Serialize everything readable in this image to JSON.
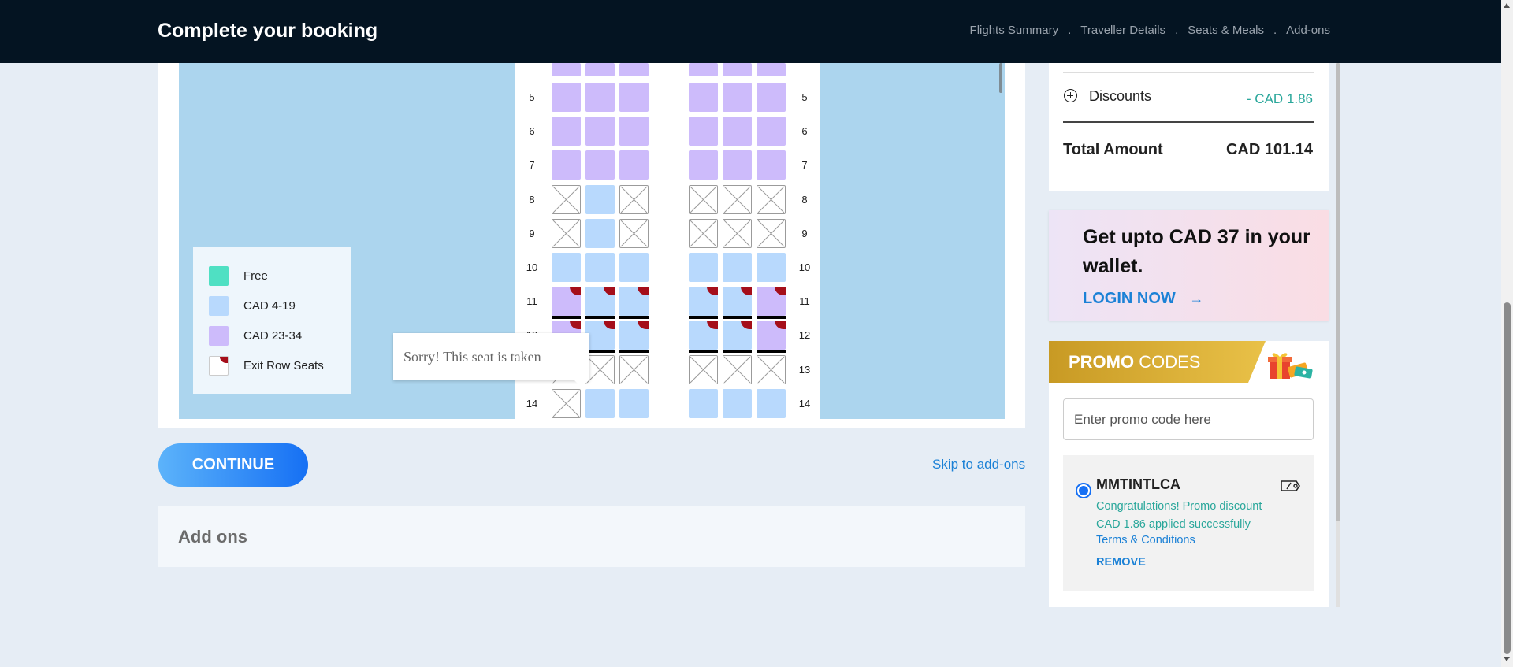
{
  "header": {
    "title": "Complete your booking",
    "steps": [
      "Flights Summary",
      "Traveller Details",
      "Seats & Meals",
      "Add-ons"
    ],
    "separator": "."
  },
  "seat_map": {
    "rows": [
      {
        "number": "5",
        "seats": [
          "purple",
          "purple",
          "purple",
          "purple",
          "purple",
          "purple"
        ],
        "exit": false
      },
      {
        "number": "6",
        "seats": [
          "purple",
          "purple",
          "purple",
          "purple",
          "purple",
          "purple"
        ],
        "exit": false
      },
      {
        "number": "7",
        "seats": [
          "purple",
          "purple",
          "purple",
          "purple",
          "purple",
          "purple"
        ],
        "exit": false
      },
      {
        "number": "8",
        "seats": [
          "taken",
          "blue",
          "taken",
          "taken",
          "taken",
          "taken"
        ],
        "exit": false
      },
      {
        "number": "9",
        "seats": [
          "taken",
          "blue",
          "taken",
          "taken",
          "taken",
          "taken"
        ],
        "exit": false
      },
      {
        "number": "10",
        "seats": [
          "blue",
          "blue",
          "blue",
          "blue",
          "blue",
          "blue"
        ],
        "exit": false
      },
      {
        "number": "11",
        "seats": [
          "purple",
          "blue",
          "blue",
          "blue",
          "blue",
          "purple"
        ],
        "exit": true
      },
      {
        "number": "12",
        "seats": [
          "purple",
          "blue",
          "blue",
          "blue",
          "blue",
          "purple"
        ],
        "exit": true
      },
      {
        "number": "13",
        "seats": [
          "taken",
          "taken",
          "taken",
          "taken",
          "taken",
          "taken"
        ],
        "exit": false
      },
      {
        "number": "14",
        "seats": [
          "taken",
          "blue",
          "blue",
          "blue",
          "blue",
          "blue"
        ],
        "exit": false
      }
    ],
    "colors": {
      "purple": "#cdbbfb",
      "blue": "#b8d9fd",
      "free": "#4fe0c3",
      "exit": "#a50e1a"
    },
    "legend": [
      {
        "label": "Free",
        "swatch": "free"
      },
      {
        "label": "CAD 4-19",
        "swatch": "blue"
      },
      {
        "label": "CAD 23-34",
        "swatch": "purple"
      },
      {
        "label": "Exit Row Seats",
        "swatch": "exit"
      }
    ],
    "tooltip": "Sorry! This seat is taken"
  },
  "actions": {
    "continue_label": "CONTINUE",
    "skip_label": "Skip to add-ons"
  },
  "addons": {
    "title": "Add ons"
  },
  "fare_summary": {
    "discount_label": "Discounts",
    "discount_value": "- CAD 1.86",
    "total_label": "Total Amount",
    "total_value": "CAD 101.14"
  },
  "wallet": {
    "message": "Get upto CAD 37 in your wallet.",
    "login_label": "LOGIN NOW",
    "arrow": "→"
  },
  "promo": {
    "title_bold": "PROMO",
    "title_rest": "CODES",
    "input_placeholder": "Enter promo code here",
    "applied": {
      "code": "MMTINTLCA",
      "message": "Congratulations! Promo discount CAD 1.86 applied successfully",
      "terms_label": "Terms & Conditions",
      "remove_label": "REMOVE"
    }
  }
}
